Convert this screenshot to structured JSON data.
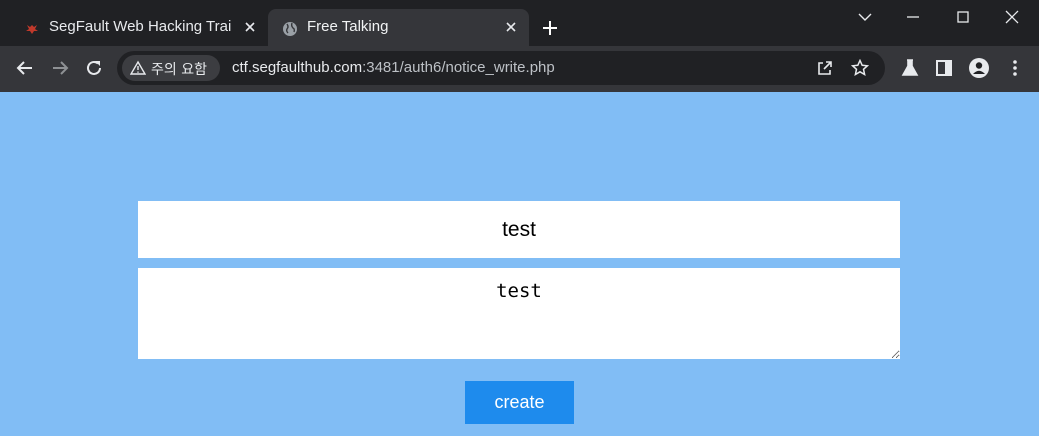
{
  "browser": {
    "tabs": [
      {
        "title": "SegFault Web Hacking Trai",
        "active": false,
        "favicon": "segfault-bug-icon",
        "favicon_color": "#c0392b"
      },
      {
        "title": "Free Talking",
        "active": true,
        "favicon": "globe-icon"
      }
    ],
    "security_chip": {
      "icon": "warning-triangle-icon",
      "label": "주의 요함"
    },
    "url": {
      "host": "ctf.segfaulthub.com",
      "path": ":3481/auth6/notice_write.php"
    },
    "toolbar_icons": [
      "back-arrow-icon",
      "forward-arrow-icon",
      "reload-icon",
      "share-icon",
      "bookmark-star-icon",
      "labs-flask-icon",
      "side-panel-icon",
      "profile-icon",
      "menu-kebab-icon"
    ],
    "window_controls": [
      "tab-search-chevron-icon",
      "minimize-icon",
      "maximize-icon",
      "close-window-icon"
    ]
  },
  "form": {
    "title_value": "test",
    "body_value": "test",
    "submit_label": "create"
  },
  "colors": {
    "page_background": "#81bdf5",
    "button_background": "#1e8bed",
    "tabstrip": "#202124",
    "toolbar": "#35363a"
  }
}
